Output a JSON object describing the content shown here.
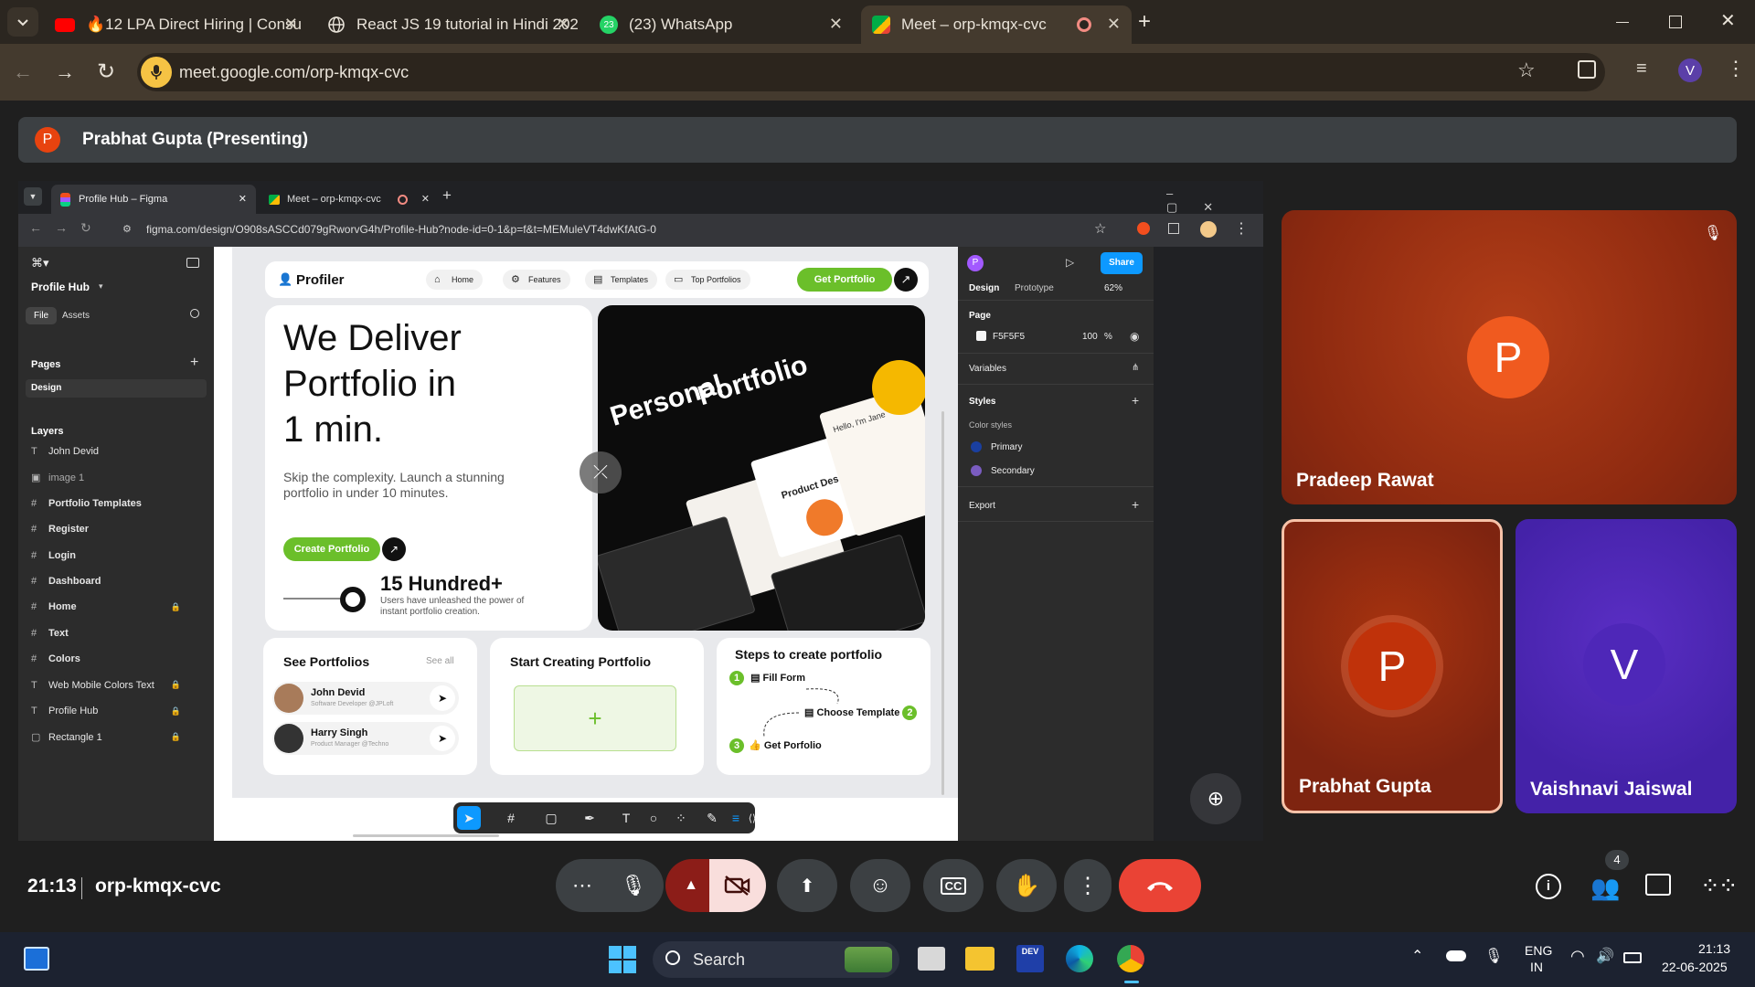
{
  "browser": {
    "tabs": [
      {
        "title": "🔥12 LPA Direct Hiring | Consu"
      },
      {
        "title": "React JS 19 tutorial in Hindi 202"
      },
      {
        "title": "(23) WhatsApp"
      },
      {
        "title": "Meet – orp-kmqx-cvc"
      }
    ],
    "whatsapp_badge": "23",
    "url": "meet.google.com/orp-kmqx-cvc",
    "profile_initial": "V"
  },
  "meet": {
    "presenter_initial": "P",
    "presenter_label": "Prabhat Gupta (Presenting)",
    "participants": [
      {
        "name": "Pradeep Rawat",
        "initial": "P"
      },
      {
        "name": "Prabhat Gupta",
        "initial": "P"
      },
      {
        "name": "Vaishnavi Jaiswal",
        "initial": "V"
      }
    ],
    "time": "21:13",
    "meeting_code": "orp-kmqx-cvc",
    "people_count": "4"
  },
  "shared_browser": {
    "tabs": [
      {
        "title": "Profile Hub – Figma"
      },
      {
        "title": "Meet – orp-kmqx-cvc"
      }
    ],
    "url": "figma.com/design/O908sASCCd079gRworvG4h/Profile-Hub?node-id=0-1&p=f&t=MEMuleVT4dwKfAtG-0"
  },
  "figma": {
    "file_name": "Profile Hub",
    "left_tabs": {
      "file": "File",
      "assets": "Assets"
    },
    "pages_label": "Pages",
    "current_page": "Design",
    "layers_label": "Layers",
    "layers": [
      {
        "name": "John Devid",
        "icon": "T",
        "locked": false
      },
      {
        "name": "image 1",
        "icon": "img",
        "locked": false
      },
      {
        "name": "Portfolio Templates",
        "icon": "#",
        "locked": false
      },
      {
        "name": "Register",
        "icon": "#",
        "locked": false
      },
      {
        "name": "Login",
        "icon": "#",
        "locked": false
      },
      {
        "name": "Dashboard",
        "icon": "#",
        "locked": false
      },
      {
        "name": "Home",
        "icon": "#",
        "locked": true
      },
      {
        "name": "Text",
        "icon": "#",
        "locked": false
      },
      {
        "name": "Colors",
        "icon": "#",
        "locked": false
      },
      {
        "name": "Web Mobile Colors Text",
        "icon": "T",
        "locked": true
      },
      {
        "name": "Profile Hub",
        "icon": "T",
        "locked": true
      },
      {
        "name": "Rectangle 1",
        "icon": "rect",
        "locked": true
      }
    ],
    "right": {
      "user_initial": "P",
      "share": "Share",
      "tab_design": "Design",
      "tab_prototype": "Prototype",
      "zoom": "62%",
      "page_label": "Page",
      "page_color": "F5F5F5",
      "page_opacity": "100",
      "percent": "%",
      "variables": "Variables",
      "styles": "Styles",
      "color_styles": "Color styles",
      "primary": "Primary",
      "secondary": "Secondary",
      "export": "Export",
      "primary_color": "#1a3fa0",
      "secondary_color": "#7a5cc0"
    }
  },
  "design": {
    "logo": "Profiler",
    "nav": [
      "Home",
      "Features",
      "Templates",
      "Top Portfolios"
    ],
    "cta": "Get Portfolio",
    "hero_line1": "We Deliver",
    "hero_line2": "Portfolio in",
    "hero_line3": "1 min.",
    "hero_sub1": "Skip the complexity. Launch a stunning",
    "hero_sub2": "portfolio in under 10 minutes.",
    "create_btn": "Create Portfolio",
    "stat_title": "15 Hundred+",
    "stat_sub1": "Users have unleashed the power of",
    "stat_sub2": "instant portfolio creation.",
    "showcase_word1": "Personal",
    "showcase_word2": "Portfolio",
    "showcase_hello": "Hello, I'm Jane",
    "showcase_designer": "Product Designer",
    "see_portfolios": "See Portfolios",
    "see_all": "See all",
    "people": [
      {
        "name": "John Devid",
        "role": "Software Developer @JPLoft"
      },
      {
        "name": "Harry Singh",
        "role": "Product Manager @Techno"
      }
    ],
    "start_creating": "Start Creating Portfolio",
    "plus": "+",
    "steps_title": "Steps to create portfolio",
    "steps": [
      {
        "n": "1",
        "label": "Fill Form"
      },
      {
        "n": "2",
        "label": "Choose Template"
      },
      {
        "n": "3",
        "label": "Get Porfolio"
      }
    ],
    "brand_green": "#6bbf2a"
  },
  "taskbar": {
    "search": "Search",
    "lang1": "ENG",
    "lang2": "IN",
    "time": "21:13",
    "date": "22-06-2025"
  }
}
